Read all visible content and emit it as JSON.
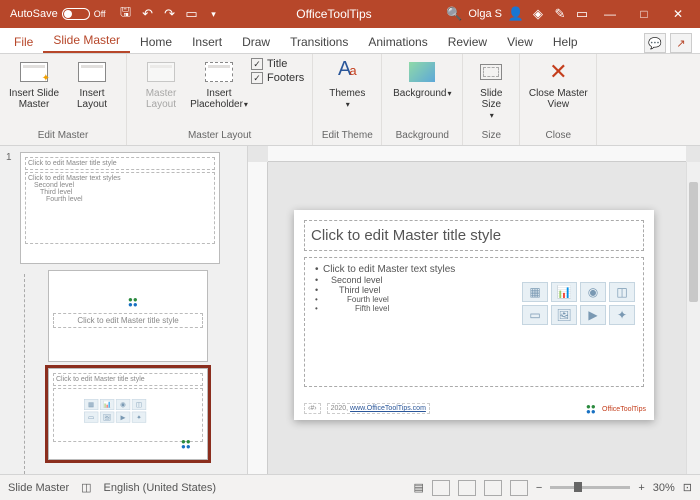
{
  "titlebar": {
    "autosave_label": "AutoSave",
    "autosave_state": "Off",
    "doc_title": "OfficeToolTips",
    "user": "Olga S"
  },
  "tabs": {
    "file": "File",
    "slide_master": "Slide Master",
    "home": "Home",
    "insert": "Insert",
    "draw": "Draw",
    "transitions": "Transitions",
    "animations": "Animations",
    "review": "Review",
    "view": "View",
    "help": "Help"
  },
  "ribbon": {
    "edit_master": {
      "label": "Edit Master",
      "insert_slide_master": "Insert Slide Master",
      "insert_layout": "Insert Layout"
    },
    "master_layout": {
      "label": "Master Layout",
      "master_layout_btn": "Master Layout",
      "insert_placeholder": "Insert Placeholder",
      "chk_title": "Title",
      "chk_footers": "Footers"
    },
    "edit_theme": {
      "label": "Edit Theme",
      "themes": "Themes"
    },
    "background": {
      "label": "Background",
      "background": "Background"
    },
    "size": {
      "label": "Size",
      "slide_size": "Slide Size"
    },
    "close": {
      "label": "Close",
      "close_master": "Close Master View"
    }
  },
  "thumb": {
    "num1": "1"
  },
  "slide": {
    "title_ph": "Click to edit Master title style",
    "body_l1": "Click to edit Master text styles",
    "body_l2": "Second level",
    "body_l3": "Third level",
    "body_l4": "Fourth level",
    "body_l5": "Fifth level",
    "footer_date": "2020,",
    "footer_url": "www.OfficeToolTips.com",
    "footer_num": "‹#›",
    "logo_text": "OfficeToolTips"
  },
  "layout2": {
    "title": "Click to edit Master title style"
  },
  "layout3": {
    "title": "Click to edit Master title style"
  },
  "status": {
    "view": "Slide Master",
    "lang": "English (United States)",
    "zoom": "30%"
  }
}
